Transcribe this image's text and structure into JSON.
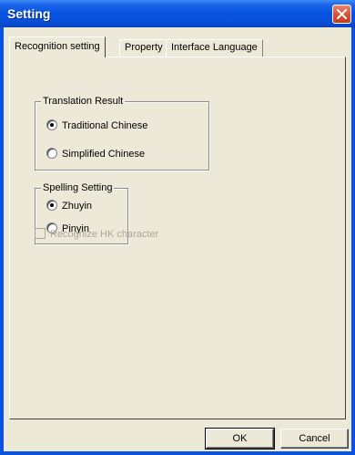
{
  "window": {
    "title": "Setting",
    "close_icon": "close-icon",
    "colors": {
      "titlebar": "#0553e1",
      "close_button": "#d85a3a",
      "client_background": "#ece9d8",
      "disabled_text": "#aca899"
    }
  },
  "tabs": [
    {
      "label": "Recognition setting",
      "active": true
    },
    {
      "label": "Property",
      "active": false
    },
    {
      "label": "Interface Language",
      "active": false
    }
  ],
  "translation_result": {
    "label": "Translation Result",
    "options": [
      {
        "label": "Traditional Chinese",
        "checked": true
      },
      {
        "label": "Simplified Chinese",
        "checked": false
      }
    ]
  },
  "spelling_setting": {
    "label": "Spelling Setting",
    "options": [
      {
        "label": "Zhuyin",
        "checked": true
      },
      {
        "label": "Pinyin",
        "checked": false
      }
    ]
  },
  "recognize_hk": {
    "label": "Recognize HK character",
    "checked": false,
    "disabled": true
  },
  "buttons": {
    "ok": "OK",
    "cancel": "Cancel"
  }
}
